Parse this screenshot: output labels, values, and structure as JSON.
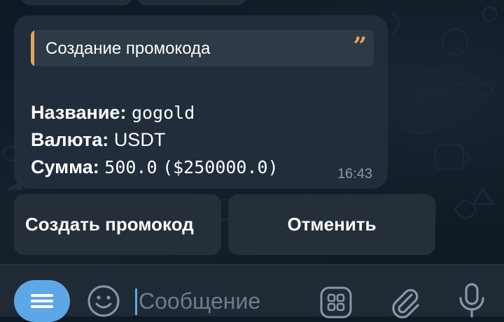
{
  "message": {
    "quote_title": "Создание промокода",
    "fields": [
      {
        "label": "Название:",
        "value": "gogold"
      },
      {
        "label": "Валюта:",
        "value": "USDT"
      },
      {
        "label": "Сумма:",
        "value": "500.0",
        "extra": "($250000.0)"
      }
    ],
    "time": "16:43"
  },
  "keyboard": {
    "create_label": "Создать промокод",
    "cancel_label": "Отменить"
  },
  "composer": {
    "placeholder": "Сообщение"
  },
  "colors": {
    "accent": "#5ea7e6",
    "quote_accent": "#e6a35b",
    "bubble": "#212d3b",
    "background": "#0f1a24"
  },
  "icons": [
    "quote-icon",
    "menu-icon",
    "emoji-icon",
    "apps-icon",
    "paperclip-icon",
    "microphone-icon"
  ]
}
